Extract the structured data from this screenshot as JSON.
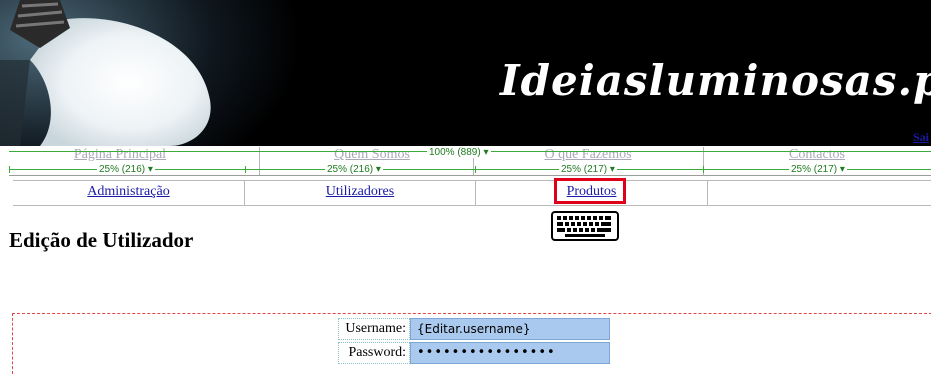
{
  "header": {
    "logo_text": "Ideiasluminosas.pt",
    "logout_label": "Sai"
  },
  "top_menu": {
    "items": [
      "Página Principal",
      "Quem Somos",
      "O que Fazemos",
      "Contactos"
    ],
    "width_hints": [
      "25% (216)",
      "25% (216)",
      "25% (217)",
      "25% (217)"
    ],
    "total_width_hint": "100% (889)"
  },
  "admin_menu": {
    "items": [
      "Administração",
      "Utilizadores",
      "Produtos",
      ""
    ]
  },
  "main": {
    "title": "Edição de Utilizador",
    "form": {
      "username_label": "Username:",
      "username_value": "{Editar.username}",
      "password_label": "Password:",
      "password_value": "••••••••••••••••"
    }
  },
  "colors": {
    "link": "#1a1aa6",
    "highlight": "#e0001b",
    "field": "#a9c9ee",
    "guide": "#3aaa3a"
  },
  "icons": [
    "lightbulb-icon",
    "keyboard-icon",
    "dropdown-arrow-icon"
  ]
}
